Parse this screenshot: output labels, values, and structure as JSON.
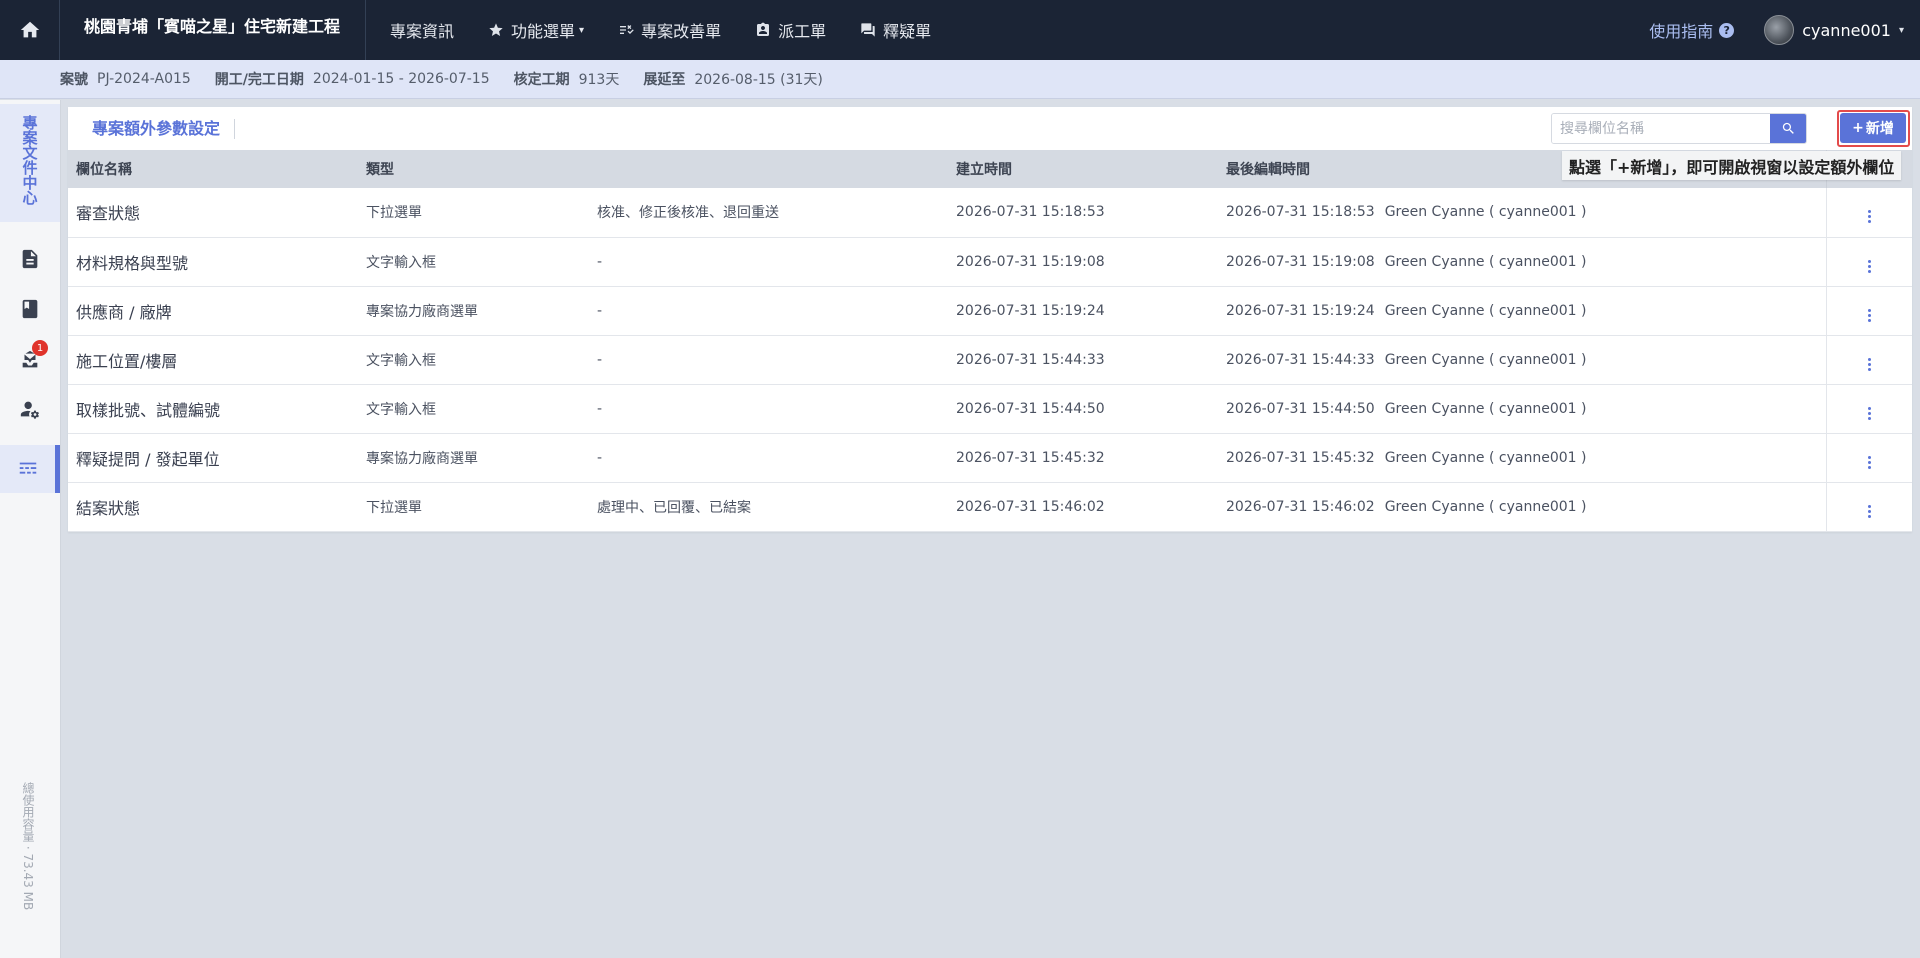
{
  "topbar": {
    "project_title": "桃園青埔「賓喵之星」住宅新建工程",
    "nav": [
      {
        "label": "專案資訊",
        "icon": ""
      },
      {
        "label": "功能選單",
        "icon": "star-icon"
      },
      {
        "label": "專案改善單",
        "icon": "checklist-icon"
      },
      {
        "label": "派工單",
        "icon": "badge-icon"
      },
      {
        "label": "釋疑單",
        "icon": "chat-icon"
      }
    ],
    "guide_label": "使用指南",
    "username": "cyanne001"
  },
  "infobar": {
    "case_no_label": "案號",
    "case_no": "PJ-2024-A015",
    "dates_label": "開工/完工日期",
    "dates": "2024-01-15 - 2026-07-15",
    "period_label": "核定工期",
    "period": "913天",
    "extend_label": "展延至",
    "extend": "2026-08-15 (31天)"
  },
  "sidebar": {
    "doc_center_label": "專案文件中心",
    "badge_count": "1",
    "usage_label": "總使用容量 · 73.43 MB"
  },
  "page": {
    "title": "專案額外參數設定",
    "search_placeholder": "搜尋欄位名稱",
    "add_label": "新增",
    "tooltip": "點選「+新增」，即可開啟視窗以設定額外欄位"
  },
  "table": {
    "headers": [
      "欄位名稱",
      "類型",
      "",
      "建立時間",
      "最後編輯時間"
    ],
    "rows": [
      {
        "name": "審查狀態",
        "type": "下拉選單",
        "options": "核准、修正後核准、退回重送",
        "created": "2026-07-31 15:18:53",
        "edited": "2026-07-31 15:18:53",
        "editor": "Green Cyanne ( cyanne001 )"
      },
      {
        "name": "材料規格與型號",
        "type": "文字輸入框",
        "options": "-",
        "created": "2026-07-31 15:19:08",
        "edited": "2026-07-31 15:19:08",
        "editor": "Green Cyanne ( cyanne001 )"
      },
      {
        "name": "供應商 / 廠牌",
        "type": "專案協力廠商選單",
        "options": "-",
        "created": "2026-07-31 15:19:24",
        "edited": "2026-07-31 15:19:24",
        "editor": "Green Cyanne ( cyanne001 )"
      },
      {
        "name": "施工位置/樓層",
        "type": "文字輸入框",
        "options": "-",
        "created": "2026-07-31 15:44:33",
        "edited": "2026-07-31 15:44:33",
        "editor": "Green Cyanne ( cyanne001 )"
      },
      {
        "name": "取樣批號、試體編號",
        "type": "文字輸入框",
        "options": "-",
        "created": "2026-07-31 15:44:50",
        "edited": "2026-07-31 15:44:50",
        "editor": "Green Cyanne ( cyanne001 )"
      },
      {
        "name": "釋疑提問 / 發起單位",
        "type": "專案協力廠商選單",
        "options": "-",
        "created": "2026-07-31 15:45:32",
        "edited": "2026-07-31 15:45:32",
        "editor": "Green Cyanne ( cyanne001 )"
      },
      {
        "name": "結案狀態",
        "type": "下拉選單",
        "options": "處理中、已回覆、已結案",
        "created": "2026-07-31 15:46:02",
        "edited": "2026-07-31 15:46:02",
        "editor": "Green Cyanne ( cyanne001 )"
      }
    ]
  },
  "colors": {
    "topbar_bg": "#1b2435",
    "accent": "#5a73d8",
    "highlight_outline": "#e34b4b",
    "badge": "#e0332b"
  }
}
